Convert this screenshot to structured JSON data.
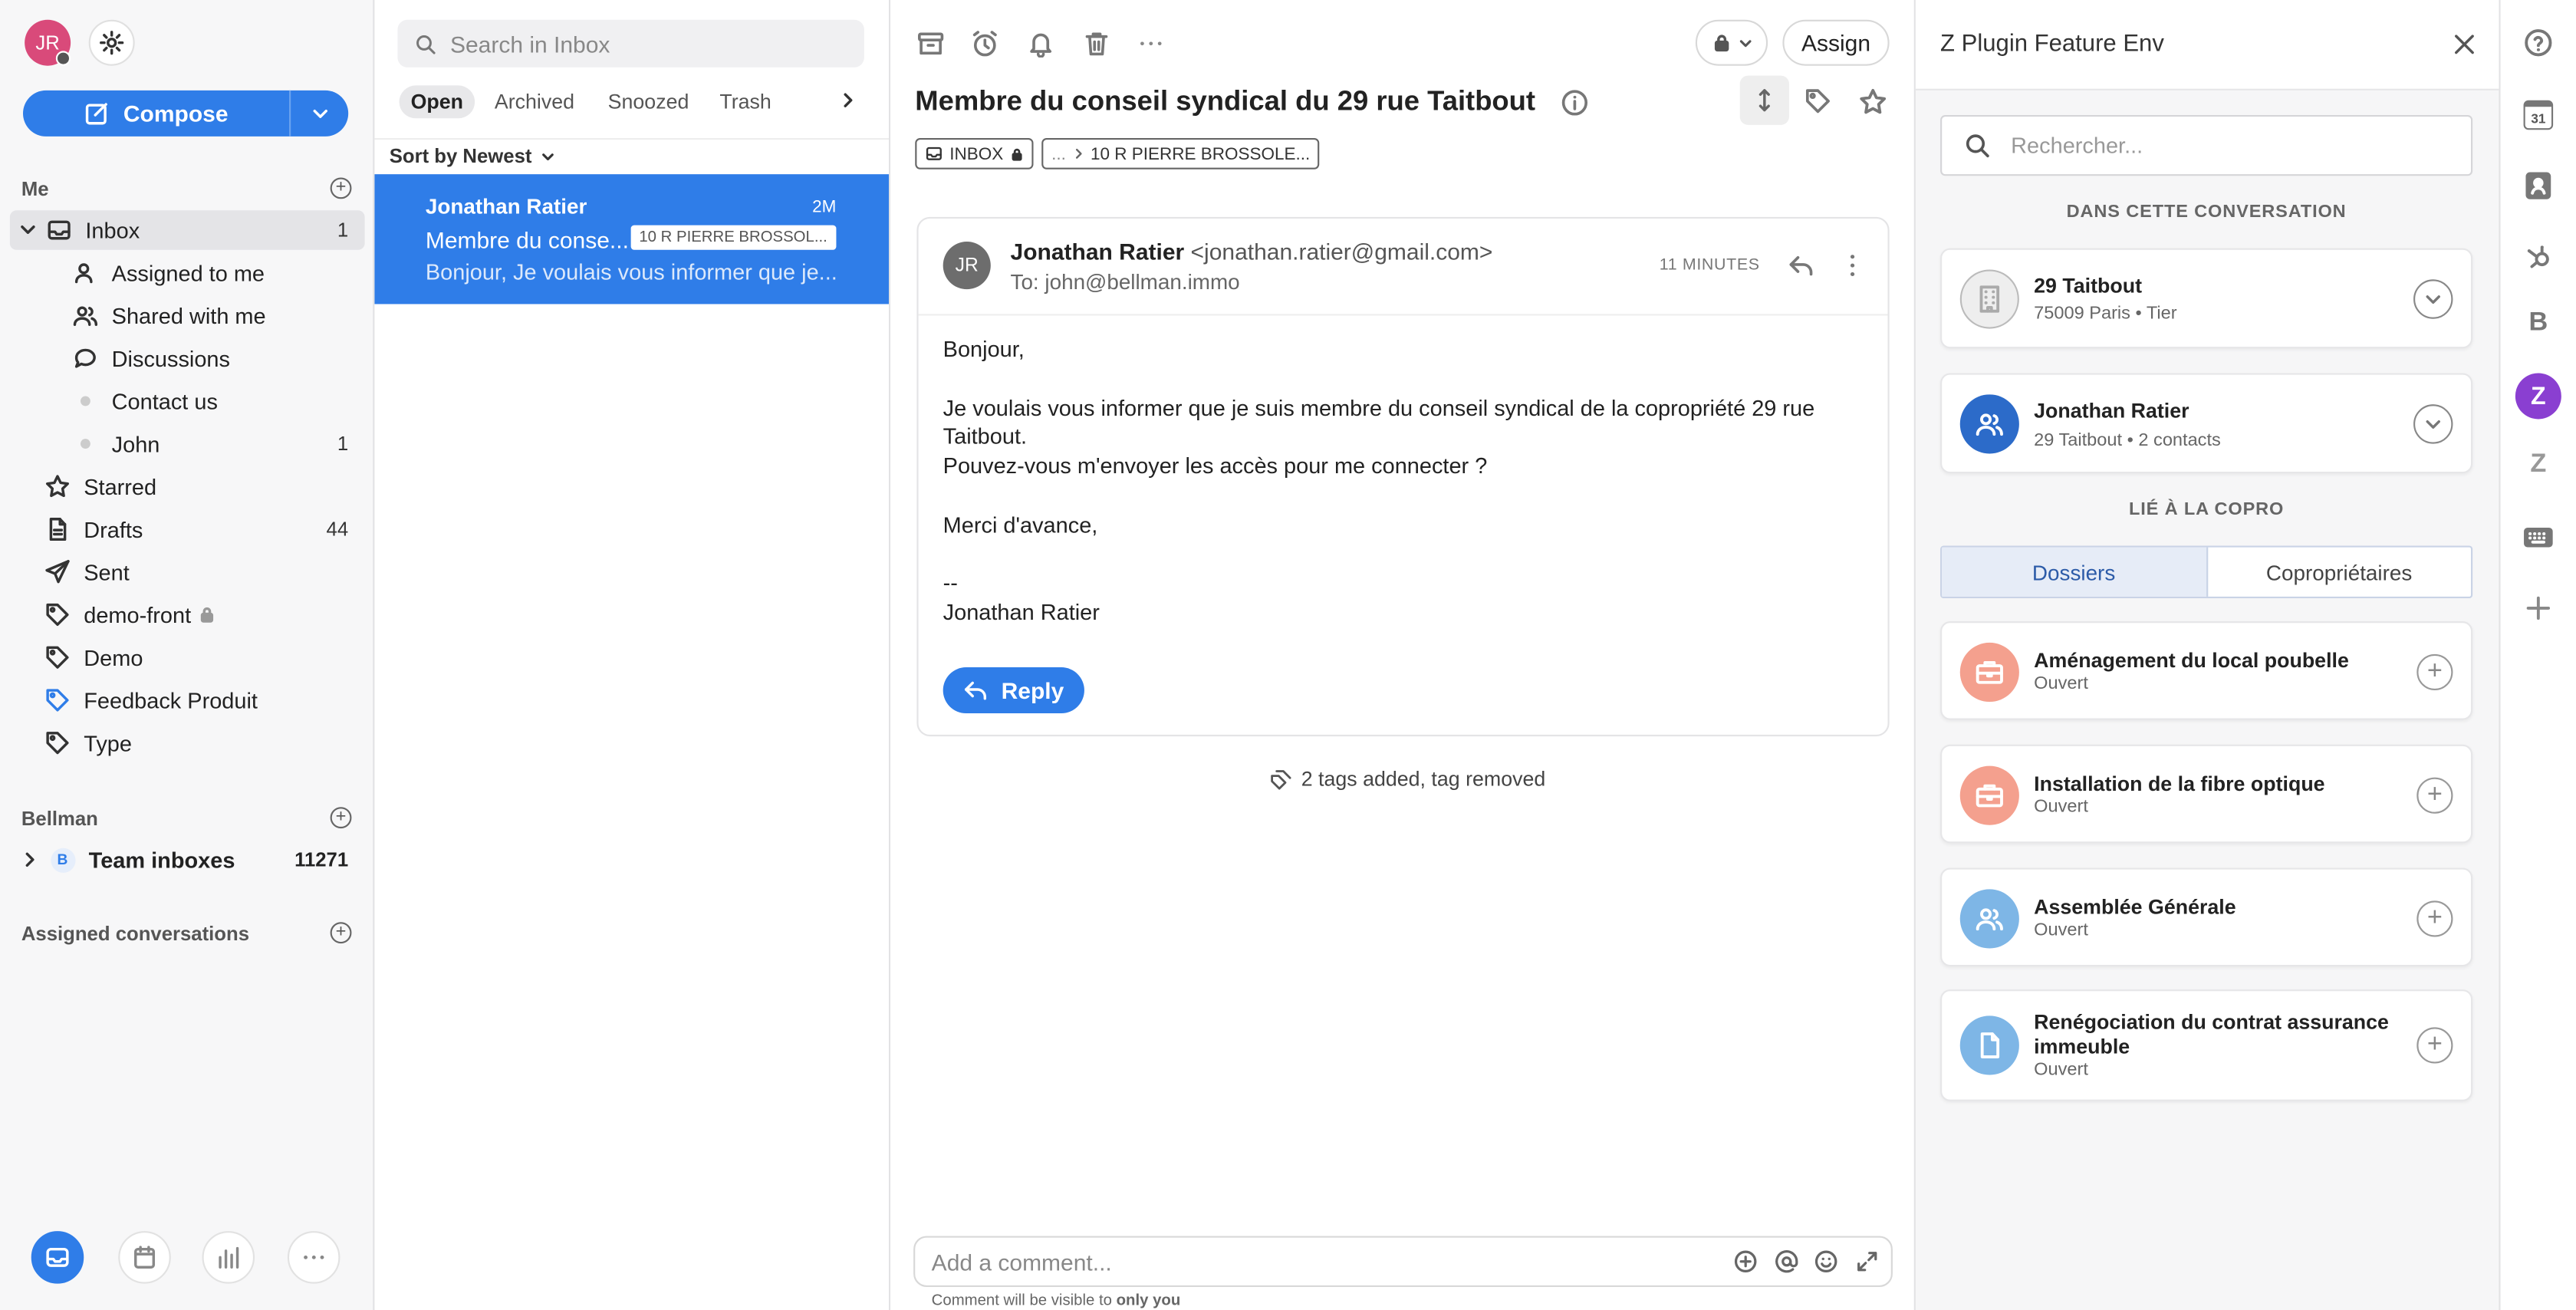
{
  "sidebar": {
    "avatar_initials": "JR",
    "compose_label": "Compose",
    "me_section": "Me",
    "items": [
      {
        "label": "Inbox",
        "count": "1"
      },
      {
        "label": "Assigned to me",
        "count": ""
      },
      {
        "label": "Shared with me",
        "count": ""
      },
      {
        "label": "Discussions",
        "count": ""
      },
      {
        "label": "Contact us",
        "count": ""
      },
      {
        "label": "John",
        "count": "1"
      },
      {
        "label": "Starred",
        "count": ""
      },
      {
        "label": "Drafts",
        "count": "44"
      },
      {
        "label": "Sent",
        "count": ""
      },
      {
        "label": "demo-front",
        "count": ""
      },
      {
        "label": "Demo",
        "count": ""
      },
      {
        "label": "Feedback Produit",
        "count": ""
      },
      {
        "label": "Type",
        "count": ""
      }
    ],
    "bellman_section": "Bellman",
    "team_inboxes": {
      "badge": "B",
      "label": "Team inboxes",
      "count": "11271"
    },
    "assigned_section": "Assigned conversations"
  },
  "list": {
    "search_placeholder": "Search in Inbox",
    "tabs": [
      "Open",
      "Archived",
      "Snoozed",
      "Trash"
    ],
    "sort_label": "Sort by Newest",
    "conversations": [
      {
        "sender": "Jonathan Ratier",
        "time": "2M",
        "subject": "Membre du conse...",
        "tag": "10 R PIERRE BROSSOL...",
        "preview": "Bonjour, Je voulais vous informer que je..."
      }
    ]
  },
  "main": {
    "assign_label": "Assign",
    "subject": "Membre du conseil syndical du 29 rue Taitbout",
    "chip_inbox": "INBOX",
    "chip_path_prefix": "...",
    "chip_path": "10 R PIERRE BROSSOLE...",
    "message": {
      "initials": "JR",
      "from_name": "Jonathan Ratier",
      "from_email": "<jonathan.ratier@gmail.com>",
      "to": "To: john@bellman.immo",
      "time": "11 MINUTES",
      "lines": [
        "Bonjour,",
        "",
        "Je voulais vous informer que je suis membre du conseil syndical de la copropriété 29 rue",
        "Taitbout.",
        "Pouvez-vous m'envoyer les accès pour me connecter ?",
        "",
        "Merci d'avance,",
        "",
        "--",
        "Jonathan Ratier"
      ],
      "reply_label": "Reply"
    },
    "activity": "2 tags added, tag removed",
    "comment_placeholder": "Add a comment...",
    "comment_hint_prefix": "Comment will be visible to ",
    "comment_hint_bold": "only you"
  },
  "plugin": {
    "title": "Z Plugin Feature Env",
    "search_placeholder": "Rechercher...",
    "section_conversation": "DANS CETTE CONVERSATION",
    "building": {
      "name": "29 Taitbout",
      "detail": "75009 Paris • Tier"
    },
    "contact": {
      "name": "Jonathan Ratier",
      "detail": "29 Taitbout • 2 contacts"
    },
    "section_copro": "LIÉ À LA COPRO",
    "tab_dossiers": "Dossiers",
    "tab_coproprietaires": "Copropriétaires",
    "dossiers": [
      {
        "title": "Aménagement du local poubelle",
        "status": "Ouvert",
        "color": "#f4a08e",
        "icon": "briefcase-icon"
      },
      {
        "title": "Installation de la fibre optique",
        "status": "Ouvert",
        "color": "#f4a08e",
        "icon": "briefcase-icon"
      },
      {
        "title": "Assemblée Générale",
        "status": "Ouvert",
        "color": "#7eb6e6",
        "icon": "people-icon"
      },
      {
        "title": "Renégociation du contrat assurance immeuble",
        "status": "Ouvert",
        "color": "#7eb6e6",
        "icon": "document-icon"
      }
    ]
  },
  "rail": {
    "calendar_day": "31",
    "b_label": "B",
    "z_label": "Z",
    "z2_label": "Z"
  },
  "colors": {
    "accent": "#2f7de8",
    "avatar": "#d94a7a",
    "z_badge": "#8a3fd1"
  }
}
